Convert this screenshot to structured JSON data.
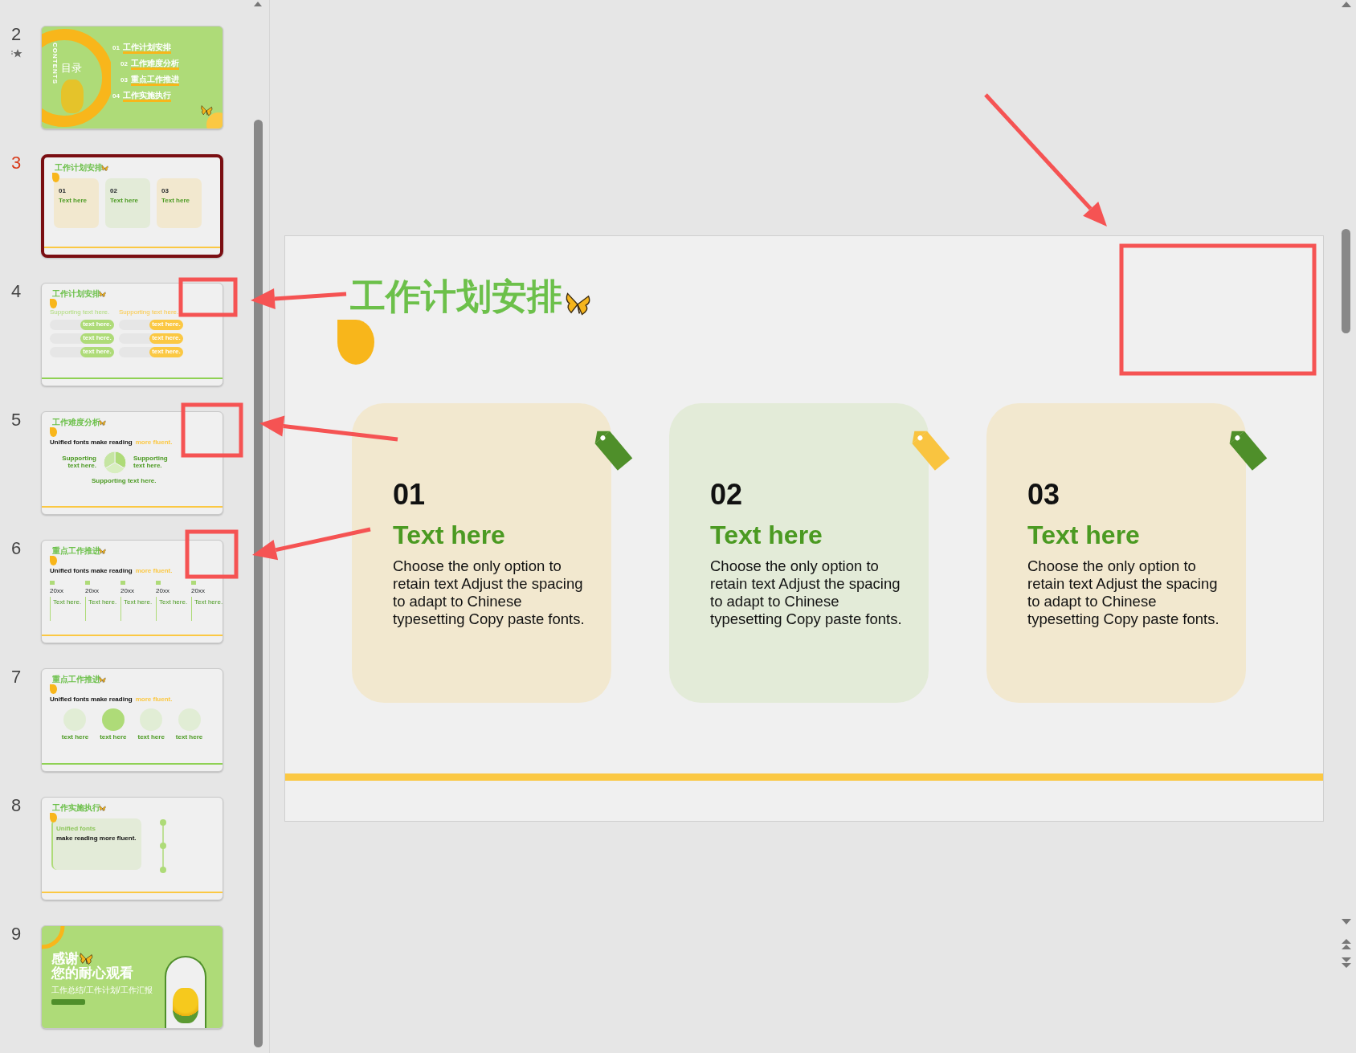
{
  "slide_panel": {
    "slides": [
      {
        "number": "2",
        "selected": false,
        "has_animation": true,
        "kind": "contents",
        "side_label": "CONTENTS",
        "title": "目录",
        "items": [
          {
            "number": "01",
            "label": "工作计划安排"
          },
          {
            "number": "02",
            "label": "工作难度分析"
          },
          {
            "number": "03",
            "label": "重点工作推进"
          },
          {
            "number": "04",
            "label": "工作实施执行"
          }
        ]
      },
      {
        "number": "3",
        "selected": true,
        "has_animation": false,
        "kind": "cards",
        "title": "工作计划安排",
        "footer": {
          "color": "#fbc843"
        },
        "cards": [
          {
            "number": "01",
            "heading": "Text here",
            "color": "#f2e8cf"
          },
          {
            "number": "02",
            "heading": "Text here",
            "color": "#e3ebd8"
          },
          {
            "number": "03",
            "heading": "Text here",
            "color": "#f2e8cf"
          }
        ]
      },
      {
        "number": "4",
        "selected": false,
        "has_animation": false,
        "kind": "pills",
        "title": "工作计划安排",
        "footer": {
          "color": "#8fd154"
        },
        "columns": [
          {
            "heading": "Supporting text here.",
            "color": "#aedb78",
            "pills": [
              "text here.",
              "text here.",
              "text here."
            ]
          },
          {
            "heading": "Supporting text here.",
            "color": "#fbc843",
            "pills": [
              "text here.",
              "text here.",
              "text here."
            ]
          }
        ]
      },
      {
        "number": "5",
        "selected": false,
        "has_animation": false,
        "kind": "pie",
        "title": "工作难度分析",
        "footer": {
          "color": "#fbc843"
        },
        "headline": "Unified fonts make reading",
        "headline_accent": "more fluent.",
        "labels": [
          "Supporting text here.",
          "Supporting text here.",
          "Supporting text here."
        ]
      },
      {
        "number": "6",
        "selected": false,
        "has_animation": false,
        "kind": "timeline",
        "title": "重点工作推进",
        "footer": {
          "color": "#fbc843"
        },
        "headline": "Unified fonts make reading",
        "headline_accent": "more fluent.",
        "columns": [
          {
            "year": "20xx",
            "heading": "Text here."
          },
          {
            "year": "20xx",
            "heading": "Text here."
          },
          {
            "year": "20xx",
            "heading": "Text here."
          },
          {
            "year": "20xx",
            "heading": "Text here."
          },
          {
            "year": "20xx",
            "heading": "Text here."
          }
        ]
      },
      {
        "number": "7",
        "selected": false,
        "has_animation": false,
        "kind": "icons",
        "title": "重点工作推进",
        "footer": {
          "color": "#8fd154"
        },
        "headline": "Unified fonts make reading",
        "headline_accent": "more fluent.",
        "items": [
          {
            "label": "text here",
            "highlighted": false
          },
          {
            "label": "text here",
            "highlighted": true
          },
          {
            "label": "text here",
            "highlighted": false
          },
          {
            "label": "text here",
            "highlighted": false
          }
        ]
      },
      {
        "number": "8",
        "selected": false,
        "has_animation": false,
        "kind": "summary",
        "title": "工作实施执行",
        "footer": {
          "color": "#fbc843"
        },
        "box_title": "Unified fonts",
        "box_subtitle": "make reading more fluent."
      },
      {
        "number": "9",
        "selected": false,
        "has_animation": false,
        "kind": "thanks",
        "title": "感谢",
        "subtitle": "您的耐心观看",
        "tagline": "工作总结/工作计划/工作汇报"
      }
    ]
  },
  "slide": {
    "title": "工作计划安排",
    "footer": {
      "color": "#fbc843"
    },
    "cards": [
      {
        "number": "01",
        "heading": "Text here",
        "body": "Choose the only option to retain text Adjust the spacing to adapt to Chinese typesetting Copy paste fonts.",
        "color": "#f2e8cf",
        "tag": {
          "color": "#4f8f2a"
        }
      },
      {
        "number": "02",
        "heading": "Text here",
        "body": "Choose the only option to retain text Adjust the spacing to adapt to Chinese typesetting Copy paste fonts.",
        "color": "#e3ebd8",
        "tag": {
          "color": "#f9c440"
        }
      },
      {
        "number": "03",
        "heading": "Text here",
        "body": "Choose the only option to retain text Adjust the spacing to adapt to Chinese typesetting Copy paste fonts.",
        "color": "#f2e8cf",
        "tag": {
          "color": "#4f8f2a"
        }
      }
    ]
  }
}
